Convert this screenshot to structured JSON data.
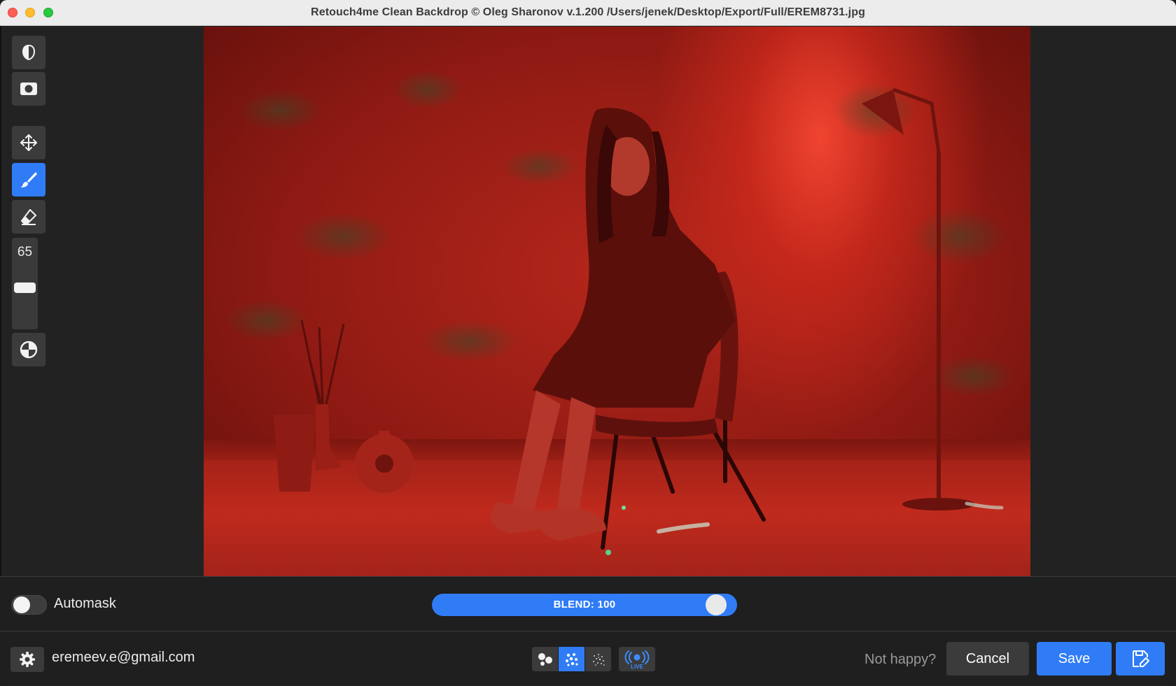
{
  "window": {
    "title": "Retouch4me Clean Backdrop © Oleg Sharonov v.1.200 /Users/jenek/Desktop/Export/Full/EREM8731.jpg"
  },
  "toolbar": {
    "tools": [
      {
        "name": "mask-overlay-tool",
        "icon": "half-shield-icon",
        "active": false
      },
      {
        "name": "show-mask-tool",
        "icon": "mask-rect-icon",
        "active": false
      },
      {
        "name": "move-tool",
        "icon": "move-arrows-icon",
        "active": false
      },
      {
        "name": "brush-tool",
        "icon": "brush-icon",
        "active": true
      },
      {
        "name": "eraser-tool",
        "icon": "eraser-icon",
        "active": false
      },
      {
        "name": "compare-tool",
        "icon": "split-circle-icon",
        "active": false
      }
    ],
    "brush_size": "65",
    "brush_size_level": 0.65
  },
  "controls": {
    "automask_label": "Automask",
    "automask_enabled": false,
    "blend_label": "BLEND: 100",
    "blend_value": 100
  },
  "footer": {
    "account_email": "eremeev.e@gmail.com",
    "modes": [
      {
        "icon": "large-spots-icon",
        "active": false
      },
      {
        "icon": "medium-spots-icon",
        "active": true
      },
      {
        "icon": "small-spots-icon",
        "active": false
      }
    ],
    "live_icon": "live-broadcast-icon",
    "live_label": "LIVE",
    "not_happy_label": "Not happy?",
    "cancel_label": "Cancel",
    "save_label": "Save",
    "save_as_icon": "save-edit-icon"
  },
  "colors": {
    "accent": "#2f7cf6",
    "button_bg": "#3b3b3b",
    "window_bg": "#1f1f1f"
  }
}
